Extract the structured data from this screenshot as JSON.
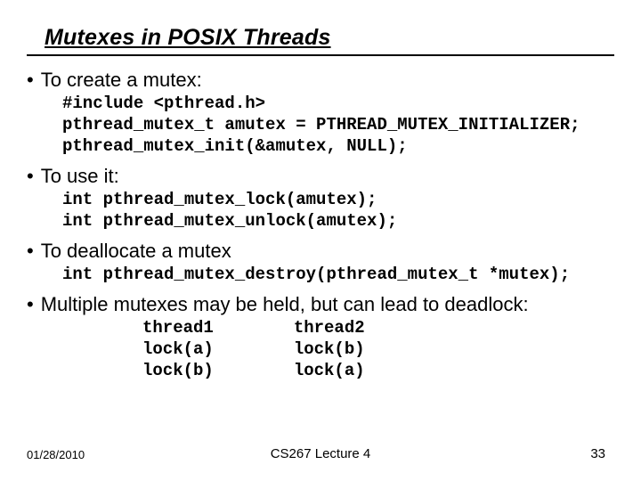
{
  "title": "Mutexes in POSIX Threads",
  "sections": [
    {
      "bullet": "To create a mutex:",
      "code": "#include <pthread.h>\npthread_mutex_t amutex = PTHREAD_MUTEX_INITIALIZER;\npthread_mutex_init(&amutex, NULL);"
    },
    {
      "bullet": "To use it:",
      "code": "int pthread_mutex_lock(amutex);\nint pthread_mutex_unlock(amutex);"
    },
    {
      "bullet": "To deallocate a mutex",
      "code": "int pthread_mutex_destroy(pthread_mutex_t *mutex);"
    },
    {
      "bullet": "Multiple mutexes may be held, but can lead to deadlock:"
    }
  ],
  "deadlock": {
    "col1": "thread1\nlock(a)\nlock(b)",
    "col2": "thread2\nlock(b)\nlock(a)"
  },
  "footer": {
    "date": "01/28/2010",
    "center": "CS267 Lecture 4",
    "page": "33"
  }
}
